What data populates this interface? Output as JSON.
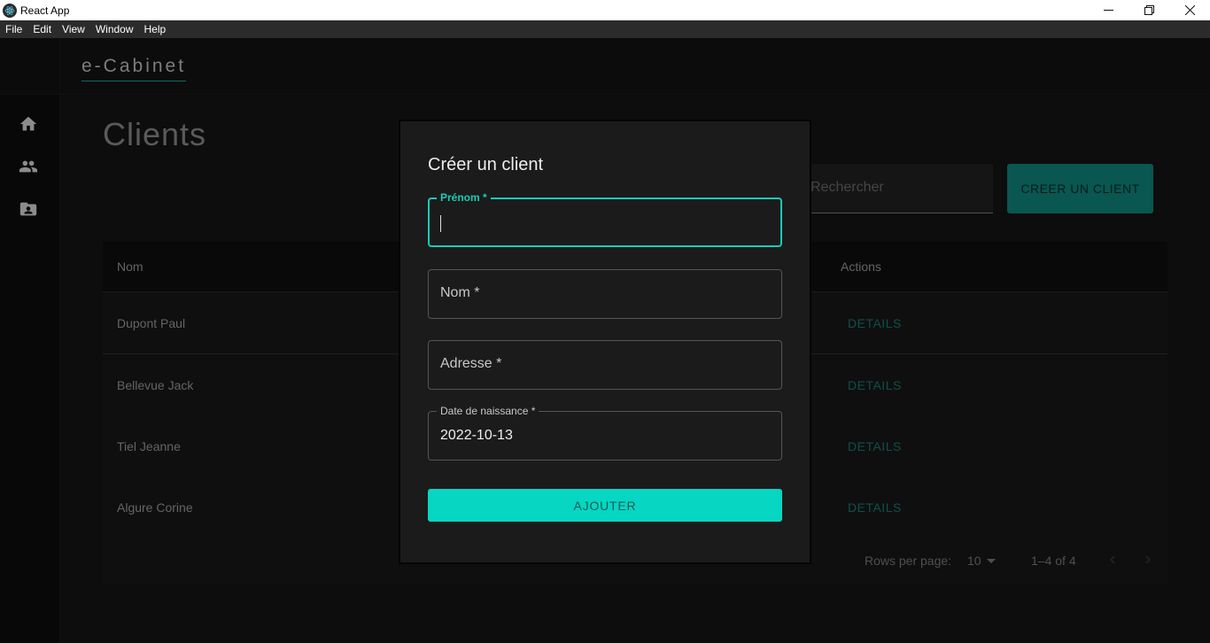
{
  "window": {
    "title": "React App",
    "controls": [
      "minimize-icon",
      "restore-icon",
      "close-icon"
    ]
  },
  "menubar": {
    "items": [
      "File",
      "Edit",
      "View",
      "Window",
      "Help"
    ]
  },
  "rail": {
    "icons": [
      "home-icon",
      "people-icon",
      "contact-folder-icon"
    ]
  },
  "header": {
    "brand": "e-Cabinet"
  },
  "page": {
    "title": "Clients",
    "search_placeholder": "Rechercher",
    "create_button": "CREER UN CLIENT"
  },
  "table": {
    "headers": {
      "name": "Nom",
      "actions": "Actions"
    },
    "rows": [
      {
        "name": "Dupont Paul",
        "action": "DETAILS"
      },
      {
        "name": "Bellevue Jack",
        "action": "DETAILS"
      },
      {
        "name": "Tiel Jeanne",
        "action": "DETAILS"
      },
      {
        "name": "Algure Corine",
        "action": "DETAILS"
      }
    ],
    "footer": {
      "rows_per_page_label": "Rows per page:",
      "rows_per_page_value": "10",
      "range": "1–4 of 4"
    }
  },
  "modal": {
    "title": "Créer un client",
    "fields": {
      "prenom": {
        "label": "Prénom *",
        "value": ""
      },
      "nom": {
        "label": "Nom *",
        "value": ""
      },
      "adresse": {
        "label": "Adresse *",
        "value": ""
      },
      "naissance": {
        "label": "Date de naissance *",
        "value": "2022-10-13"
      }
    },
    "submit": "AJOUTER"
  },
  "colors": {
    "accent": "#19cbb8",
    "button_teal": "#10857b",
    "submit_teal": "#07d6c3",
    "background": "#141414"
  }
}
